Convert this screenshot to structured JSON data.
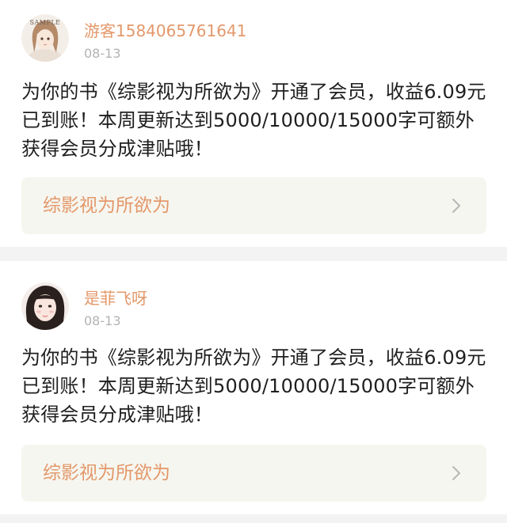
{
  "theme": {
    "accent": "#e3986a",
    "text": "#1f1f1f",
    "muted": "#b3b3b3",
    "card_link_bg": "#f6f6f0",
    "page_bg": "#f3f3f3"
  },
  "feed": {
    "posts": [
      {
        "avatar_icon": "user-avatar-icon",
        "avatar_text": "SAMPLE",
        "username": "游客1584065761641",
        "date": "08-13",
        "message": "为你的书《综影视为所欲为》开通了会员，收益6.09元已到账！本周更新达到5000/10000/15000字可额外获得会员分成津贴哦！",
        "book_title": "综影视为所欲为",
        "chevron_icon": "chevron-right-icon"
      },
      {
        "avatar_icon": "user-avatar-icon",
        "username": "是菲飞呀",
        "date": "08-13",
        "message": "为你的书《综影视为所欲为》开通了会员，收益6.09元已到账！本周更新达到5000/10000/15000字可额外获得会员分成津贴哦！",
        "book_title": "综影视为所欲为",
        "chevron_icon": "chevron-right-icon"
      }
    ]
  }
}
